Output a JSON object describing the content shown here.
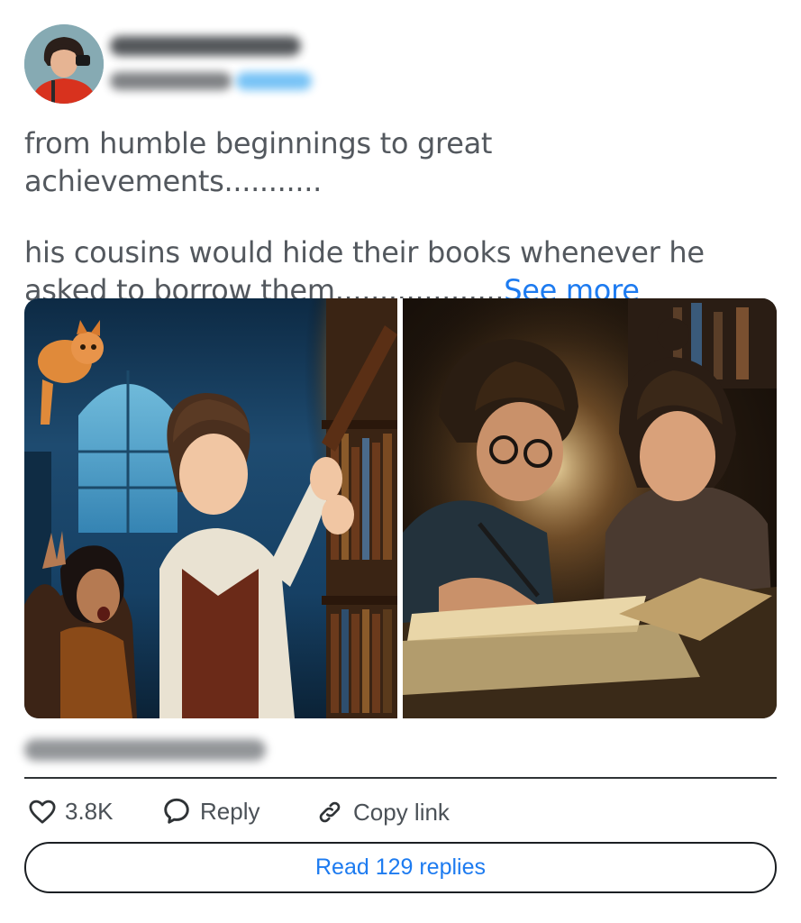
{
  "author": {
    "avatar_icon": "profile-avatar"
  },
  "post": {
    "paragraph1": "from humble beginnings to great achievements...........",
    "paragraph2": "his cousins would hide their books whenever he asked to borrow them...................",
    "see_more": "See more"
  },
  "actions": {
    "like_icon": "heart-icon",
    "like_count": "3.8K",
    "reply_icon": "speech-bubble-icon",
    "reply_label": "Reply",
    "copy_icon": "link-icon",
    "copy_label": "Copy link"
  },
  "read_replies_label": "Read 129 replies",
  "colors": {
    "accent": "#1d7bf0",
    "text_muted": "#53585e",
    "divider": "#2f3336"
  }
}
